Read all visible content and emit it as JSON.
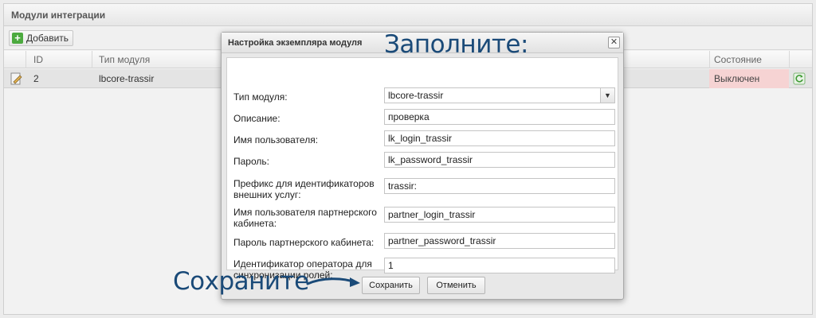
{
  "panel": {
    "title": "Модули интеграции",
    "add_label": "Добавить"
  },
  "grid": {
    "columns": {
      "id": "ID",
      "type": "Тип модуля",
      "status": "Состояние"
    },
    "rows": [
      {
        "id": "2",
        "type": "lbcore-trassir",
        "status": "Выключен"
      }
    ]
  },
  "dialog": {
    "title": "Настройка экземпляра модуля",
    "close_label": "✕",
    "fields": {
      "module_type": {
        "label": "Тип модуля:",
        "value": "lbcore-trassir"
      },
      "description": {
        "label": "Описание:",
        "value": "проверка"
      },
      "username": {
        "label": "Имя пользователя:",
        "value": "lk_login_trassir"
      },
      "password": {
        "label": "Пароль:",
        "value": "lk_password_trassir"
      },
      "prefix": {
        "label_line1": "Префикс для идентификаторов",
        "label_line2": "внешних услуг:",
        "value": "trassir:"
      },
      "partner_login": {
        "label_line1": "Имя пользователя партнерского",
        "label_line2": "кабинета:",
        "value": "partner_login_trassir"
      },
      "partner_password": {
        "label": "Пароль партнерского кабинета:",
        "value": "partner_password_trassir"
      },
      "operator_id": {
        "label_line1": "Идентификатор оператора для",
        "label_line2": "синхронизации ролей:",
        "value": "1"
      }
    },
    "save_label": "Сохранить",
    "cancel_label": "Отменить"
  },
  "annotations": {
    "fill": "Заполните:",
    "save": "Сохраните"
  },
  "colors": {
    "status_off_bg": "#f6d3d3",
    "annotation": "#1a4a78",
    "add_icon": "#4caa3f"
  }
}
